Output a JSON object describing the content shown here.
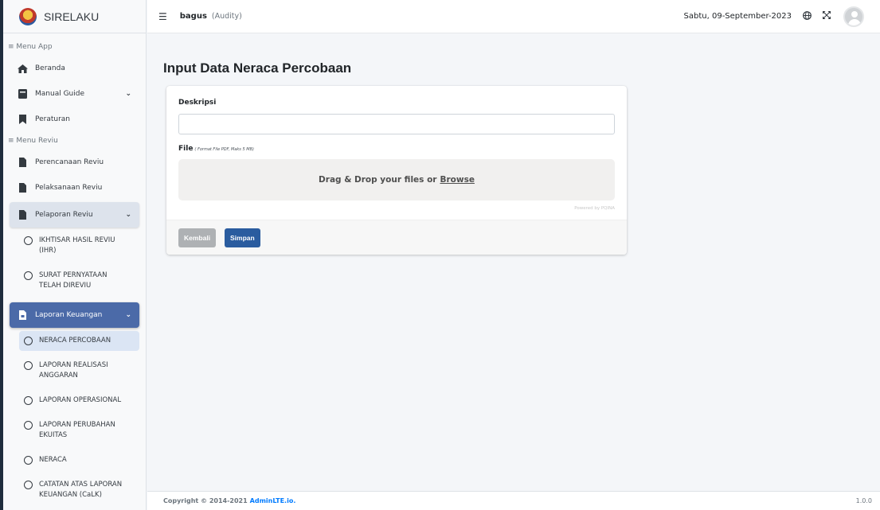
{
  "brand": {
    "name": "SIRELAKU"
  },
  "topbar": {
    "user_name": "bagus",
    "user_role": "(Audity)",
    "date": "Sabtu, 09-September-2023"
  },
  "sidebar": {
    "header_app": "≡ Menu App",
    "header_reviu": "≡ Menu Reviu",
    "items": {
      "beranda": "Beranda",
      "manual_guide": "Manual Guide",
      "peraturan": "Peraturan",
      "perencanaan": "Perencanaan Reviu",
      "pelaksanaan": "Pelaksanaan Reviu",
      "pelaporan": "Pelaporan Reviu",
      "ihr": "IKHTISAR HASIL REVIU (IHR)",
      "surat": "SURAT PERNYATAAN TELAH DIREVIU",
      "laporan_keuangan": "Laporan Keuangan",
      "neraca_percobaan": "NERACA PERCOBAAN",
      "lra": "LAPORAN REALISASI ANGGARAN",
      "lo": "LAPORAN OPERASIONAL",
      "lpe": "LAPORAN PERUBAHAN EKUITAS",
      "neraca": "NERACA",
      "calk": "CATATAN ATAS LAPORAN KEUANGAN (CaLK)"
    }
  },
  "main": {
    "title": "Input Data Neraca Percobaan",
    "deskripsi_label": "Deskripsi",
    "deskripsi_value": "",
    "file_label": "File",
    "file_hint": "( Format File PDF, Maks 5 MB)",
    "dropzone_text": "Drag & Drop your files or",
    "browse": "Browse",
    "powered": "Powered by PQINA",
    "back_label": "Kembali",
    "save_label": "Simpan"
  },
  "footer": {
    "copyright": "Copyright © 2014-2021",
    "link": "AdminLTE.io.",
    "version": "1.0.0"
  }
}
